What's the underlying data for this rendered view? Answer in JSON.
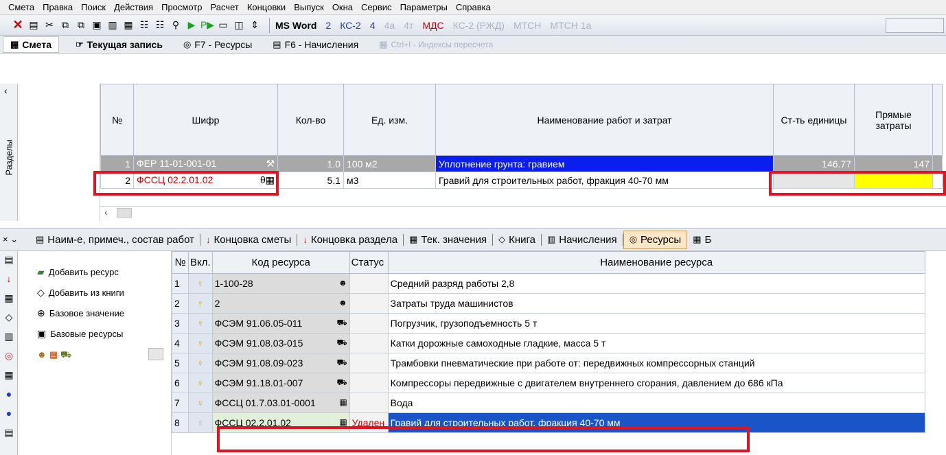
{
  "menu": [
    "Смета",
    "Правка",
    "Поиск",
    "Действия",
    "Просмотр",
    "Расчет",
    "Концовки",
    "Выпуск",
    "Окна",
    "Сервис",
    "Параметры",
    "Справка"
  ],
  "toolbar": {
    "doc_buttons": [
      {
        "label": "MS Word",
        "style": "bold"
      },
      {
        "label": "2",
        "style": "blue"
      },
      {
        "label": "КС-2",
        "style": "blue"
      },
      {
        "label": "4",
        "style": "blue"
      },
      {
        "label": "4а",
        "style": "gray"
      },
      {
        "label": "4т",
        "style": "gray"
      },
      {
        "label": "МДС",
        "style": "red"
      },
      {
        "label": "КС-2 (РЖД)",
        "style": "gray"
      },
      {
        "label": "МТСН",
        "style": "gray"
      },
      {
        "label": "МТСН 1а",
        "style": "gray"
      }
    ]
  },
  "tabs": {
    "smeta": "Смета",
    "current": "Текущая запись",
    "resources": "F7 - Ресурсы",
    "accruals": "F6 - Начисления",
    "indexes": "Ctrl+I - Индексы пересчета"
  },
  "sections_label": "Разделы",
  "upper_grid": {
    "headers": {
      "num": "№",
      "code": "Шифр",
      "qty": "Кол-во",
      "unit": "Ед. изм.",
      "name": "Наименование работ и затрат",
      "unit_cost": "Ст-ть единицы",
      "direct": "Прямые затраты"
    },
    "rows": [
      {
        "num": "1",
        "code": "ФЕР 11-01-001-01",
        "qty": "1.0",
        "unit": "100 м2",
        "name": "Уплотнение грунта: гравием",
        "unit_cost": "146.77",
        "direct": "147"
      },
      {
        "num": "2",
        "code": "ФССЦ 02.2.01.02",
        "qty": "5.1",
        "unit": "м3",
        "name": "Гравий для строительных работ, фракция 40-70 мм",
        "unit_cost": "",
        "direct": ""
      }
    ]
  },
  "lower_tabs": [
    {
      "label": "Наим-е, примеч., состав работ",
      "icon": "doc-icon"
    },
    {
      "label": "Концовка сметы",
      "icon": "red-arrow-icon"
    },
    {
      "label": "Концовка раздела",
      "icon": "red-arrow-p-icon"
    },
    {
      "label": "Тек. значения",
      "icon": "values-icon"
    },
    {
      "label": "Книга",
      "icon": "book-icon"
    },
    {
      "label": "Начисления",
      "icon": "calculator-icon"
    },
    {
      "label": "Ресурсы",
      "icon": "resources-icon"
    },
    {
      "label": "Б",
      "icon": "table-icon"
    }
  ],
  "resource_actions": {
    "add": "Добавить ресурс",
    "add_from_book": "Добавить из книги",
    "base_value": "Базовое значение",
    "base_resources": "Базовые ресурсы"
  },
  "resource_grid": {
    "headers": {
      "num": "№",
      "vkl": "Вкл.",
      "code": "Код ресурса",
      "status": "Статус",
      "name": "Наименование ресурса"
    },
    "rows": [
      {
        "num": "1",
        "code": "1-100-28",
        "type": "people",
        "status": "",
        "name": "Средний разряд работы 2,8"
      },
      {
        "num": "2",
        "code": "2",
        "type": "people",
        "status": "",
        "name": "Затраты труда машинистов"
      },
      {
        "num": "3",
        "code": "ФСЭМ 91.06.05-011",
        "type": "machine",
        "status": "",
        "name": "Погрузчик, грузоподъемность 5 т"
      },
      {
        "num": "4",
        "code": "ФСЭМ 91.08.03-015",
        "type": "machine",
        "status": "",
        "name": "Катки дорожные самоходные гладкие, масса 5 т"
      },
      {
        "num": "5",
        "code": "ФСЭМ 91.08.09-023",
        "type": "machine",
        "status": "",
        "name": "Трамбовки пневматические при работе от: передвижных компрессорных станций"
      },
      {
        "num": "6",
        "code": "ФСЭМ 91.18.01-007",
        "type": "machine",
        "status": "",
        "name": "Компрессоры передвижные с двигателем внутреннего сгорания, давлением до 686 кПа"
      },
      {
        "num": "7",
        "code": "ФССЦ 01.7.03.01-0001",
        "type": "material",
        "status": "",
        "name": "Вода"
      },
      {
        "num": "8",
        "code": "ФССЦ 02.2.01.02",
        "type": "material",
        "status": "Удален",
        "name": "Гравий для строительных работ, фракция 40-70 мм"
      }
    ]
  },
  "colors": {
    "highlight": "#e0141e",
    "selection": "#0a1ef0",
    "yellow": "#ffff00"
  }
}
